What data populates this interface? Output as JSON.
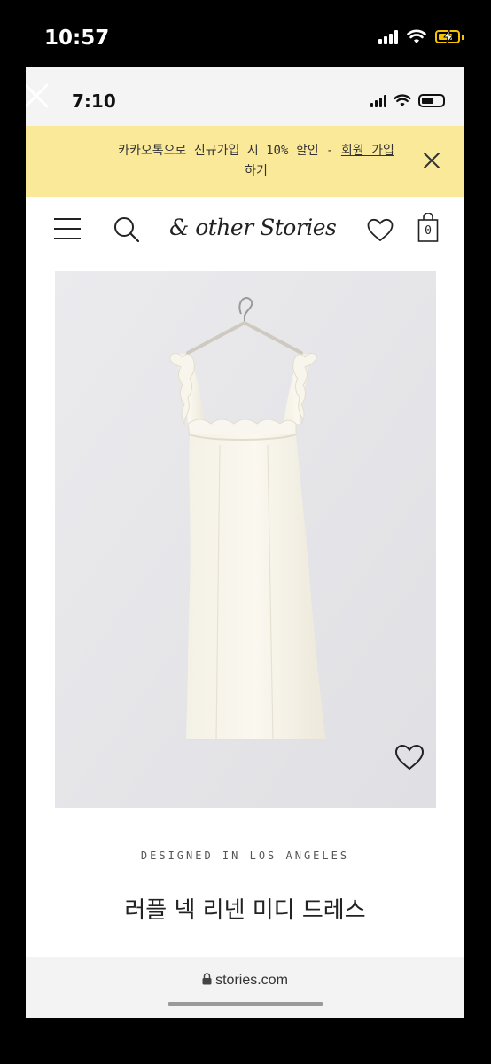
{
  "outer_status": {
    "time": "10:57"
  },
  "browser": {
    "status_time": "7:10",
    "promo": {
      "text": "카카오톡으로 신규가입 시 10% 할인 - ",
      "link": "회원 가입 하기"
    },
    "brand_logo": "& other Stories",
    "cart_count": "0",
    "designed_label": "DESIGNED IN LOS ANGELES",
    "product_title": "러플 넥 리넨 미디 드레스",
    "address": "stories.com"
  },
  "icons": {
    "viewer_close": "close-icon",
    "promo_close": "close-icon",
    "menu": "hamburger-menu-icon",
    "search": "search-icon",
    "wishlist": "heart-outline-icon",
    "bag": "shopping-bag-icon",
    "lock": "lock-icon"
  }
}
